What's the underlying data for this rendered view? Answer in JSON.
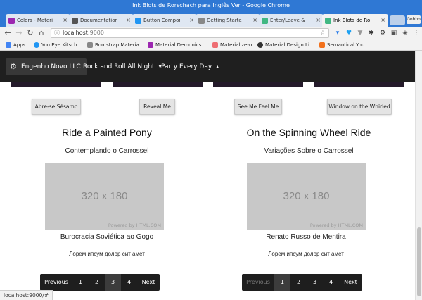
{
  "window": {
    "title": "Ink Blots de Rorschach para Inglês Ver - Google Chrome",
    "profile_label": "Gobbo"
  },
  "tabs": [
    {
      "label": "Colors - Material",
      "fav_color": "#9c27b0"
    },
    {
      "label": "Documentation",
      "fav_color": "#555555"
    },
    {
      "label": "Button Compon",
      "fav_color": "#2196f3"
    },
    {
      "label": "Getting Starte",
      "fav_color": "#888888"
    },
    {
      "label": "Enter/Leave &",
      "fav_color": "#41b883"
    },
    {
      "label": "Ink Blots de Ro",
      "fav_color": "#41b883"
    }
  ],
  "address": {
    "host": "localhost",
    "port": ":9000"
  },
  "bookmarks": [
    {
      "label": "Apps",
      "color": "#4285f4"
    },
    {
      "label": "You Eye Kitsch",
      "color": "#2196f3"
    },
    {
      "label": "Bootstrap Materia",
      "color": "#888888"
    },
    {
      "label": "Material Demonics",
      "color": "#9c27b0"
    },
    {
      "label": "Materialize-o",
      "color": "#ee6e73"
    },
    {
      "label": "Material Design Li",
      "color": "#333333"
    },
    {
      "label": "Semantical You",
      "color": "#f2711c"
    }
  ],
  "nav": {
    "brand": "Engenho Novo LLC",
    "links": [
      {
        "label": "Rock and Roll All Night",
        "chevron": "▾"
      },
      {
        "label": "Party Every Day",
        "chevron": "▴"
      }
    ]
  },
  "buttons": [
    {
      "label": "Abre-se Sésamo"
    },
    {
      "label": "Reveal Me"
    },
    {
      "label": "See Me Feel Me"
    },
    {
      "label": "Window on the Whirled"
    }
  ],
  "cards": [
    {
      "title": "Ride a Painted Pony",
      "subtitle": "Contemplando o Carrossel",
      "placeholder": "320 x 180",
      "powered": "Powered by HTML.COM",
      "caption": "Burocracia Soviética ao Gogo",
      "body": "Лорем ипсум долор сит амет",
      "pager": {
        "prev": "Previous",
        "pages": [
          "1",
          "2",
          "3",
          "4"
        ],
        "next": "Next",
        "active": "3"
      }
    },
    {
      "title": "On the Spinning Wheel Ride",
      "subtitle": "Variações Sobre o Carrossel",
      "placeholder": "320 x 180",
      "powered": "Powered by HTML.COM",
      "caption": "Renato Russo de Mentira",
      "body": "Лорем ипсум долор сит амет",
      "pager": {
        "prev": "Previous",
        "pages": [
          "1",
          "2",
          "3",
          "4"
        ],
        "next": "Next",
        "active": "1"
      }
    }
  ],
  "status_url": "localhost:9000/#"
}
